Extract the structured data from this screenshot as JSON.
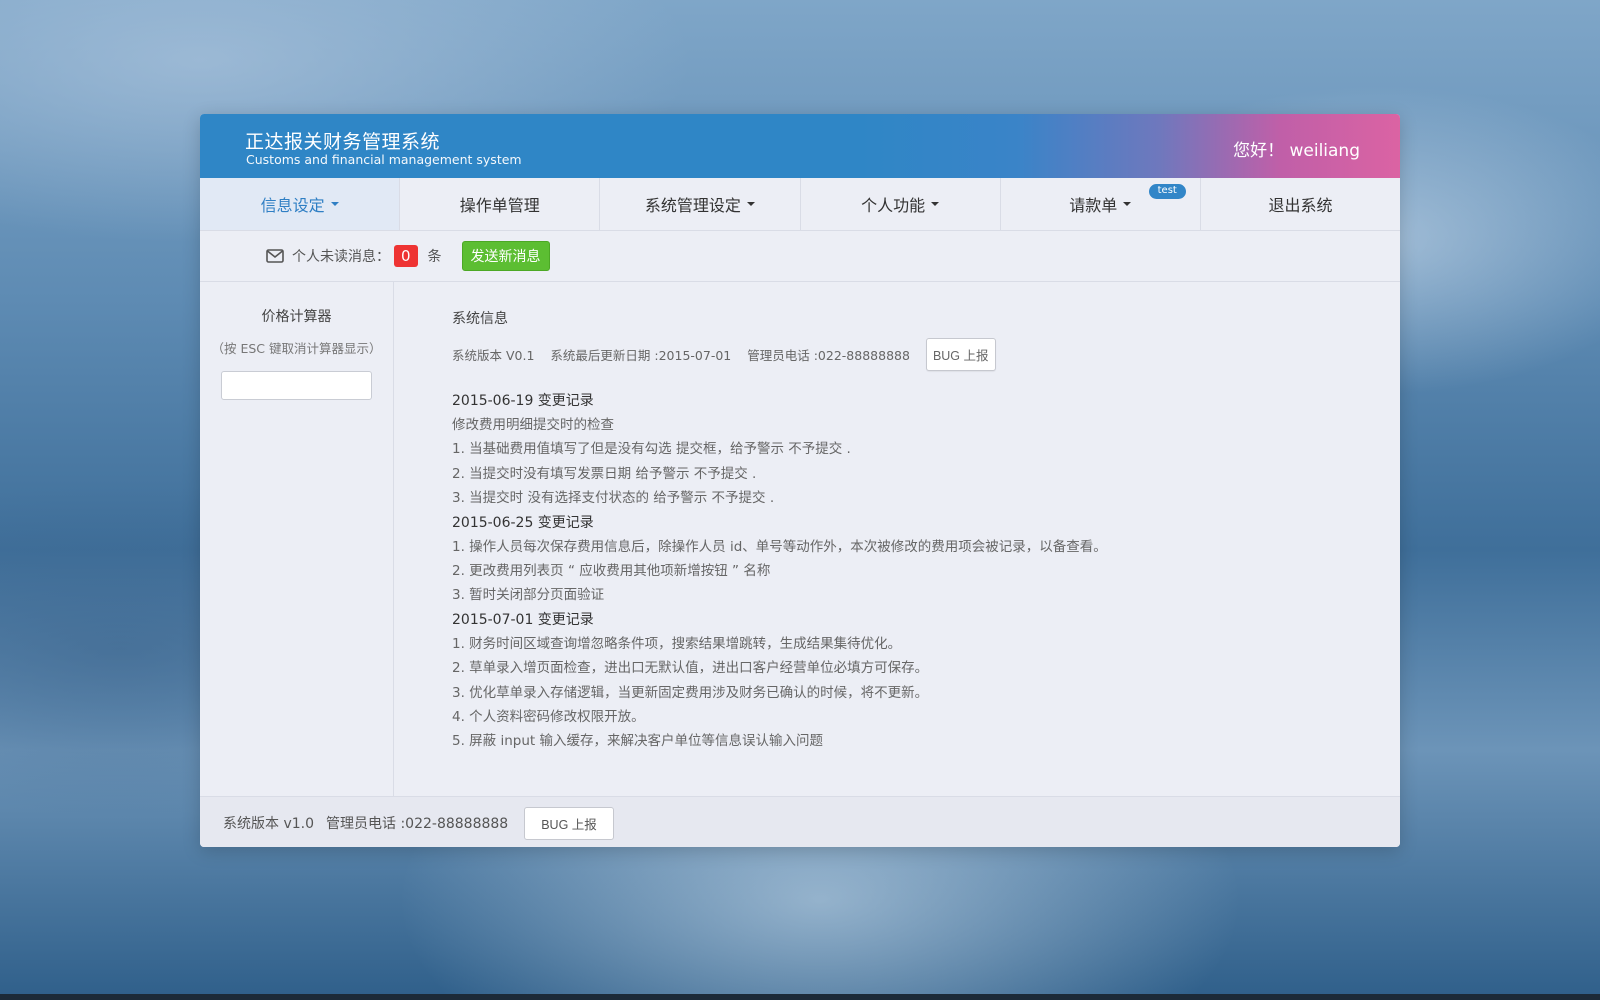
{
  "header": {
    "title_cn": "正达报关财务管理系统",
    "title_en": "Customs and financial management system",
    "greeting": "您好！ weiliang"
  },
  "nav": [
    {
      "label": "信息设定",
      "dropdown": true,
      "active": true
    },
    {
      "label": "操作单管理",
      "dropdown": false
    },
    {
      "label": "系统管理设定",
      "dropdown": true
    },
    {
      "label": "个人功能",
      "dropdown": true
    },
    {
      "label": "请款单",
      "dropdown": true,
      "badge": "test"
    },
    {
      "label": "退出系统",
      "dropdown": false
    }
  ],
  "messages": {
    "label": "个人未读消息：",
    "count": "0",
    "unit": "条",
    "send_button": "发送新消息"
  },
  "sidebar": {
    "calc_title": "价格计算器",
    "calc_hint": "（按 ESC 键取消计算器显示）",
    "calc_input_value": ""
  },
  "content": {
    "section_title": "系统信息",
    "version": "系统版本 V0.1",
    "updated": "系统最后更新日期 :2015-07-01",
    "phone": "管理员电话 :022-88888888",
    "bug_button": "BUG 上报",
    "changelog": [
      {
        "date": "2015-06-19 变更记录",
        "lines": [
          "修改费用明细提交时的检查",
          "1. 当基础费用值填写了但是没有勾选 提交框，给予警示 不予提交 .",
          "2. 当提交时没有填写发票日期 给予警示 不予提交 .",
          "3. 当提交时 没有选择支付状态的 给予警示 不予提交 ."
        ]
      },
      {
        "date": "2015-06-25 变更记录",
        "lines": [
          "1. 操作人员每次保存费用信息后，除操作人员 id、单号等动作外，本次被修改的费用项会被记录，以备查看。",
          "2. 更改费用列表页 “ 应收费用其他项新增按钮 ” 名称",
          "3. 暂时关闭部分页面验证"
        ]
      },
      {
        "date": "2015-07-01 变更记录",
        "lines": [
          "1. 财务时间区域查询增忽略条件项，搜索结果增跳转，生成结果集待优化。",
          "2. 草单录入增页面检查，进出口无默认值，进出口客户经营单位必填方可保存。",
          "3. 优化草单录入存储逻辑，当更新固定费用涉及财务已确认的时候，将不更新。",
          "4. 个人资料密码修改权限开放。",
          "5. 屏蔽 input 输入缓存，来解决客户单位等信息误认输入问题"
        ]
      }
    ]
  },
  "footer": {
    "version": "系统版本 v1.0",
    "phone": "管理员电话 :022-88888888",
    "bug_button": "BUG 上报"
  },
  "colors": {
    "header_blue": "#2f86c6",
    "header_pink": "#db63a3",
    "active_nav_text": "#2f7fc4",
    "send_green": "#5cbe32",
    "count_red": "#e33"
  }
}
